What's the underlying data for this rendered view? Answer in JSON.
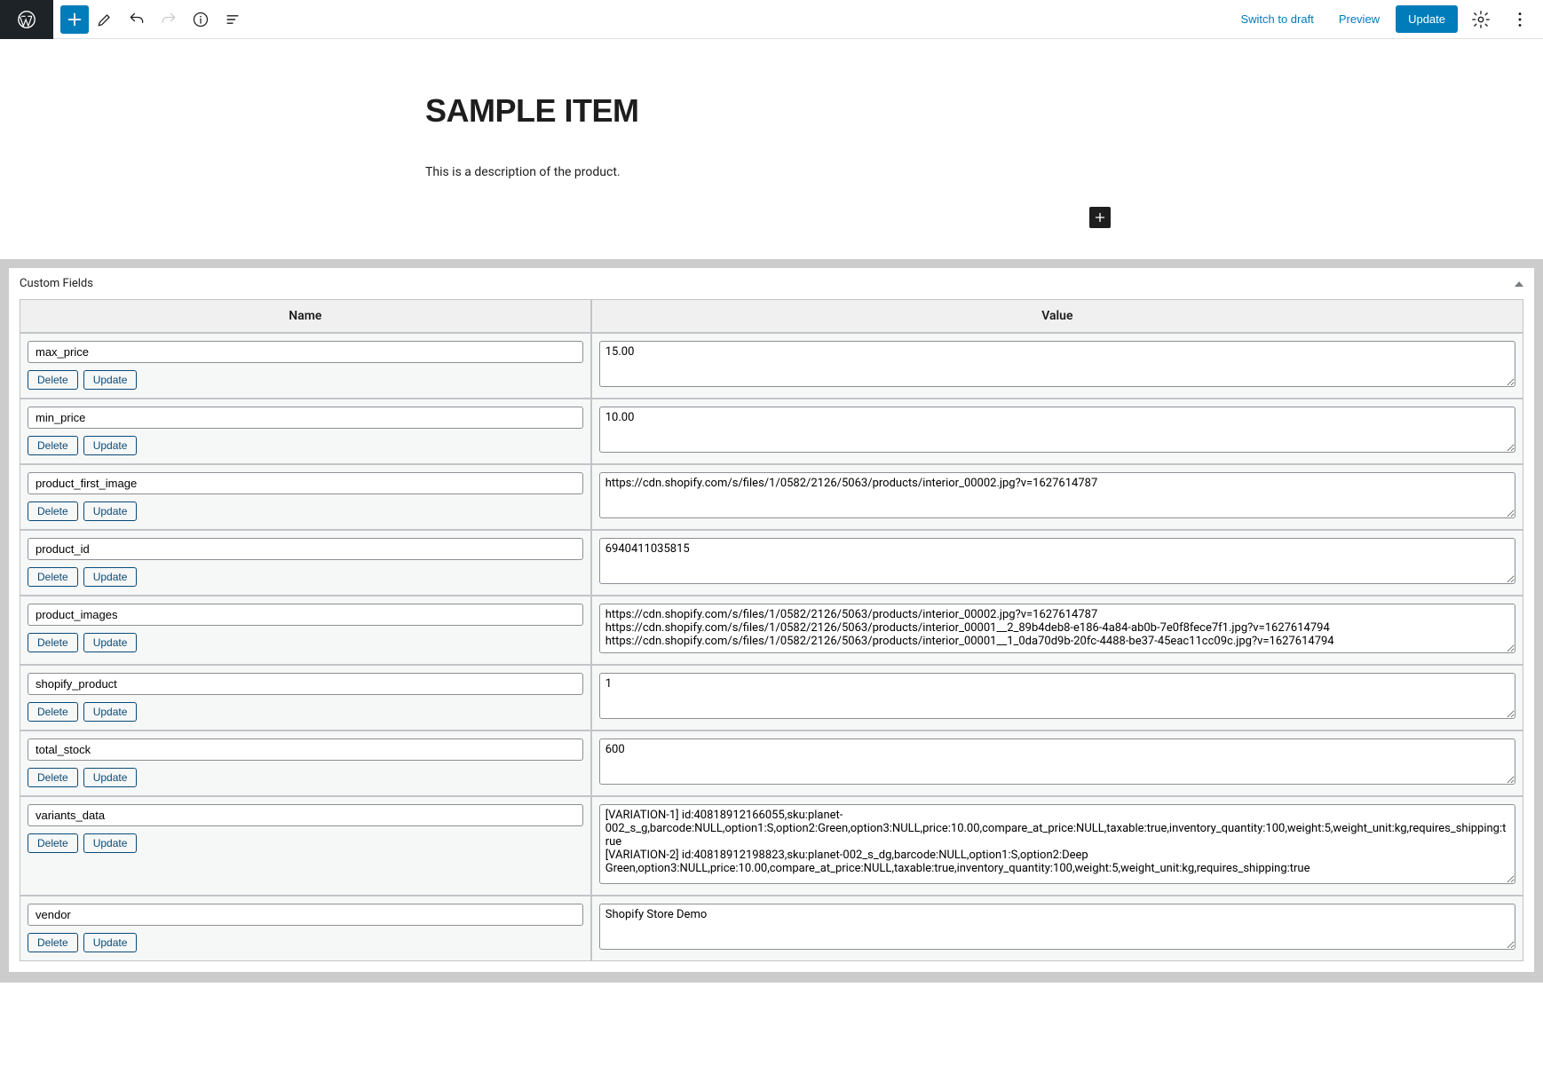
{
  "toolbar": {
    "switch_to_draft": "Switch to draft",
    "preview": "Preview",
    "update": "Update"
  },
  "post": {
    "title": "SAMPLE ITEM",
    "description": "This is a description of the product."
  },
  "custom_fields": {
    "panel_title": "Custom Fields",
    "col_name": "Name",
    "col_value": "Value",
    "delete_label": "Delete",
    "update_label": "Update",
    "rows": [
      {
        "name": "max_price",
        "value": "15.00",
        "h": "h1"
      },
      {
        "name": "min_price",
        "value": "10.00",
        "h": "h1"
      },
      {
        "name": "product_first_image",
        "value": "https://cdn.shopify.com/s/files/1/0582/2126/5063/products/interior_00002.jpg?v=1627614787",
        "h": "h1"
      },
      {
        "name": "product_id",
        "value": "6940411035815",
        "h": "h1"
      },
      {
        "name": "product_images",
        "value": "https://cdn.shopify.com/s/files/1/0582/2126/5063/products/interior_00002.jpg?v=1627614787\nhttps://cdn.shopify.com/s/files/1/0582/2126/5063/products/interior_00001__2_89b4deb8-e186-4a84-ab0b-7e0f8fece7f1.jpg?v=1627614794\nhttps://cdn.shopify.com/s/files/1/0582/2126/5063/products/interior_00001__1_0da70d9b-20fc-4488-be37-45eac11cc09c.jpg?v=1627614794",
        "h": "h2"
      },
      {
        "name": "shopify_product",
        "value": "1",
        "h": "h1"
      },
      {
        "name": "total_stock",
        "value": "600",
        "h": "h1"
      },
      {
        "name": "variants_data",
        "value": "[VARIATION-1] id:40818912166055,sku:planet-002_s_g,barcode:NULL,option1:S,option2:Green,option3:NULL,price:10.00,compare_at_price:NULL,taxable:true,inventory_quantity:100,weight:5,weight_unit:kg,requires_shipping:true\n[VARIATION-2] id:40818912198823,sku:planet-002_s_dg,barcode:NULL,option1:S,option2:Deep Green,option3:NULL,price:10.00,compare_at_price:NULL,taxable:true,inventory_quantity:100,weight:5,weight_unit:kg,requires_shipping:true",
        "h": "h3"
      },
      {
        "name": "vendor",
        "value": "Shopify Store Demo",
        "h": "h1"
      }
    ]
  }
}
